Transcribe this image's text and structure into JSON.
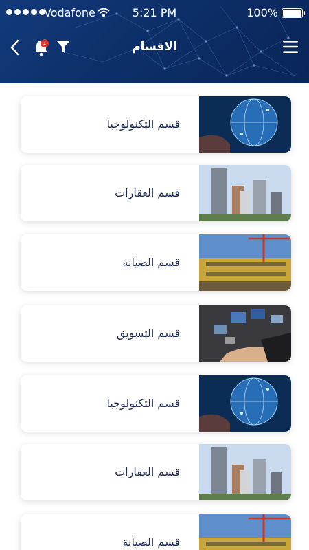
{
  "status_bar": {
    "carrier": "Vodafone",
    "time": "5:21 PM",
    "battery": "100%"
  },
  "header": {
    "title": "الاقسام",
    "notification_count": "1",
    "icons": [
      "back-chevron-icon",
      "bell-icon",
      "filter-icon",
      "hamburger-menu-icon"
    ]
  },
  "colors": {
    "header_bg": "#0d2f69",
    "card_text": "#1c2a55",
    "badge": "#e0302a"
  },
  "sections": [
    {
      "label": "قسم التكنولوجيا",
      "image": "technology-globe-image"
    },
    {
      "label": "قسم العقارات",
      "image": "real-estate-buildings-image"
    },
    {
      "label": "قسم الصيانة",
      "image": "maintenance-construction-image"
    },
    {
      "label": "قسم التسويق",
      "image": "marketing-hand-image"
    },
    {
      "label": "قسم التكنولوجيا",
      "image": "technology-globe-image"
    },
    {
      "label": "قسم العقارات",
      "image": "real-estate-buildings-image"
    },
    {
      "label": "قسم الصيانة",
      "image": "maintenance-construction-image"
    }
  ]
}
